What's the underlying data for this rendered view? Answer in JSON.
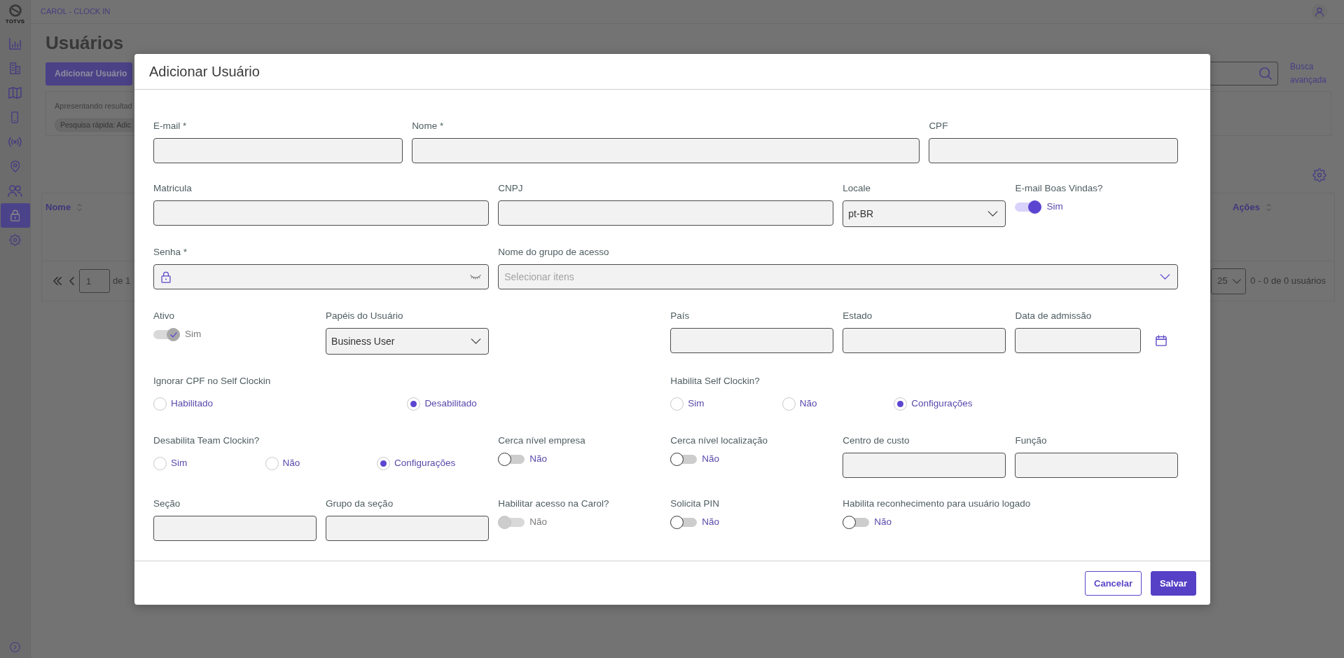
{
  "sidebar": {
    "logo_text": "TOTVS",
    "items": [
      {
        "selected": false
      },
      {
        "selected": false
      },
      {
        "selected": false
      },
      {
        "selected": false
      },
      {
        "selected": false
      },
      {
        "selected": false
      },
      {
        "selected": false
      },
      {
        "selected": true
      },
      {
        "selected": false
      }
    ]
  },
  "header": {
    "breadcrumb": "CAROL - CLOCK IN"
  },
  "page": {
    "title": "Usuários",
    "add_button": "Adicionar Usuário",
    "advanced_search_link": "Busca avançada",
    "filter": {
      "summary": "Apresentando resultad",
      "chip": "Pesquisa rápida: Adic"
    },
    "table": {
      "columns": [
        {
          "label": "Nome"
        },
        {
          "label": "Ações"
        }
      ]
    },
    "pagination": {
      "page": "1",
      "page_count": "de 1",
      "page_size": "25",
      "range": "0 - 0 de 0 usuários"
    }
  },
  "modal": {
    "title": "Adicionar Usuário",
    "fields": [
      {
        "kind": "text",
        "label": "E-mail *"
      },
      {
        "kind": "text",
        "label": "Nome *"
      },
      {
        "kind": "text",
        "label": "CPF"
      },
      {
        "kind": "text",
        "label": "Matricula"
      },
      {
        "kind": "text",
        "label": "CNPJ"
      },
      {
        "kind": "select",
        "label": "Locale",
        "value": "pt-BR"
      },
      {
        "kind": "toggle",
        "label": "E-mail Boas Vindas?",
        "on": true,
        "disabled": false,
        "text": "Sim"
      },
      {
        "kind": "password",
        "label": "Senha *"
      },
      {
        "kind": "multiselect",
        "label": "Nome do grupo de acesso",
        "placeholder": "Selecionar itens"
      },
      {
        "kind": "toggle",
        "label": "Ativo",
        "on": true,
        "disabled": true,
        "text": "Sim"
      },
      {
        "kind": "select",
        "label": "Papéis do Usuário",
        "value": "Business User"
      },
      {
        "kind": "text",
        "label": "País"
      },
      {
        "kind": "text",
        "label": "Estado"
      },
      {
        "kind": "date",
        "label": "Data de admissão"
      },
      {
        "kind": "radio",
        "label": "Ignorar CPF no Self Clockin",
        "options": [
          {
            "label": "Habilitado",
            "selected": false
          },
          {
            "label": "Desabilitado",
            "selected": true
          }
        ]
      },
      {
        "kind": "radio",
        "label": "Habilita Self Clockin?",
        "options": [
          {
            "label": "Sim",
            "selected": false
          },
          {
            "label": "Não",
            "selected": false
          },
          {
            "label": "Configurações",
            "selected": true
          }
        ]
      },
      {
        "kind": "radio",
        "label": "Desabilita Team Clockin?",
        "options": [
          {
            "label": "Sim",
            "selected": false
          },
          {
            "label": "Não",
            "selected": false
          },
          {
            "label": "Configurações",
            "selected": true
          }
        ]
      },
      {
        "kind": "toggle",
        "label": "Cerca nível empresa",
        "on": false,
        "disabled": false,
        "text": "Não"
      },
      {
        "kind": "toggle",
        "label": "Cerca nível localização",
        "on": false,
        "disabled": false,
        "text": "Não"
      },
      {
        "kind": "text",
        "label": "Centro de custo"
      },
      {
        "kind": "text",
        "label": "Função"
      },
      {
        "kind": "text",
        "label": "Seção"
      },
      {
        "kind": "text",
        "label": "Grupo da seção"
      },
      {
        "kind": "toggle",
        "label": "Habilitar acesso na Carol?",
        "on": false,
        "disabled": true,
        "text": "Não"
      },
      {
        "kind": "toggle",
        "label": "Solicita PIN",
        "on": false,
        "disabled": false,
        "text": "Não"
      },
      {
        "kind": "toggle",
        "label": "Habilita reconhecimento para usuário logado",
        "on": false,
        "disabled": false,
        "text": "Não"
      }
    ],
    "buttons": [
      {
        "label": "Cancelar",
        "kind": "outline"
      },
      {
        "label": "Salvar",
        "kind": "primary"
      }
    ]
  }
}
